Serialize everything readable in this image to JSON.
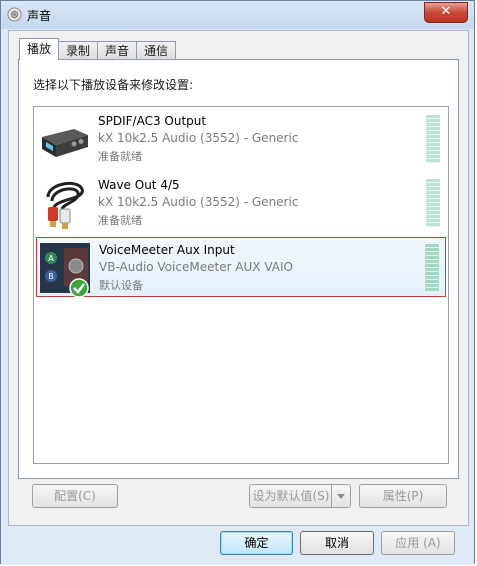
{
  "window": {
    "title": "声音",
    "close_label": "✕"
  },
  "tabs": [
    {
      "label": "播放"
    },
    {
      "label": "录制"
    },
    {
      "label": "声音"
    },
    {
      "label": "通信"
    }
  ],
  "instruction": "选择以下播放设备来修改设置:",
  "devices": [
    {
      "name": "SPDIF/AC3 Output",
      "description": "kX 10k2.5 Audio (3552) - Generic",
      "status": "准备就绪",
      "icon": "sound-card-icon",
      "selected": false
    },
    {
      "name": "Wave Out 4/5",
      "description": "kX 10k2.5 Audio (3552) - Generic",
      "status": "准备就绪",
      "icon": "rca-cable-icon",
      "selected": false
    },
    {
      "name": "VoiceMeeter Aux Input",
      "description": "VB-Audio VoiceMeeter AUX VAIO",
      "status": "默认设备",
      "icon": "voicemeeter-icon",
      "selected": true
    }
  ],
  "panel_buttons": {
    "configure": "配置(C)",
    "set_default": "设为默认值(S)",
    "properties": "属性(P)"
  },
  "dialog_buttons": {
    "ok": "确定",
    "cancel": "取消",
    "apply": "应用 (A)"
  },
  "colors": {
    "selection_border": "#c33f33",
    "primary_button": "#3c7fb1"
  }
}
